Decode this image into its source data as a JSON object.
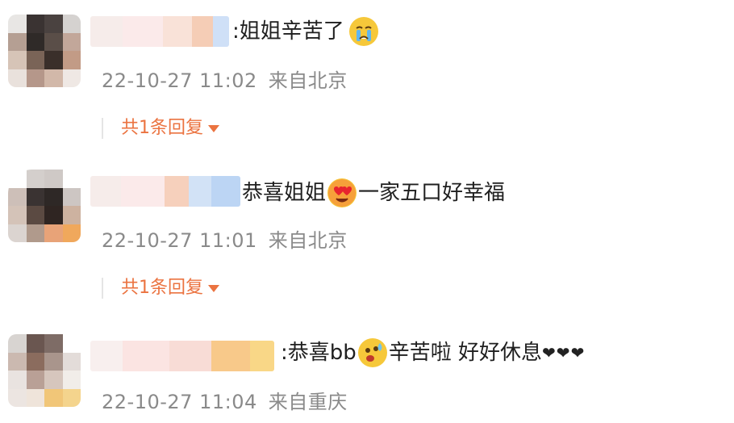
{
  "comments": [
    {
      "text": ":姐姐辛苦了",
      "emoji": "crying-face",
      "time": "22-10-27 11:02",
      "location": "来自北京",
      "replies": "共1条回复"
    },
    {
      "text": "恭喜姐姐",
      "emoji": "heart-eyes-face",
      "text_after": "一家五口好幸福",
      "time": "22-10-27 11:01",
      "location": "来自北京",
      "replies": "共1条回复"
    },
    {
      "text": ":恭喜bb",
      "emoji": "sweating-face",
      "text_after": " 辛苦啦 好好休息",
      "hearts": "❤❤❤",
      "time": "22-10-27 11:04",
      "location": "来自重庆"
    }
  ],
  "colors": {
    "meta_text": "#8a8a8a",
    "reply_accent": "#eb7340",
    "emoji_yellow": "#f6c83a"
  }
}
